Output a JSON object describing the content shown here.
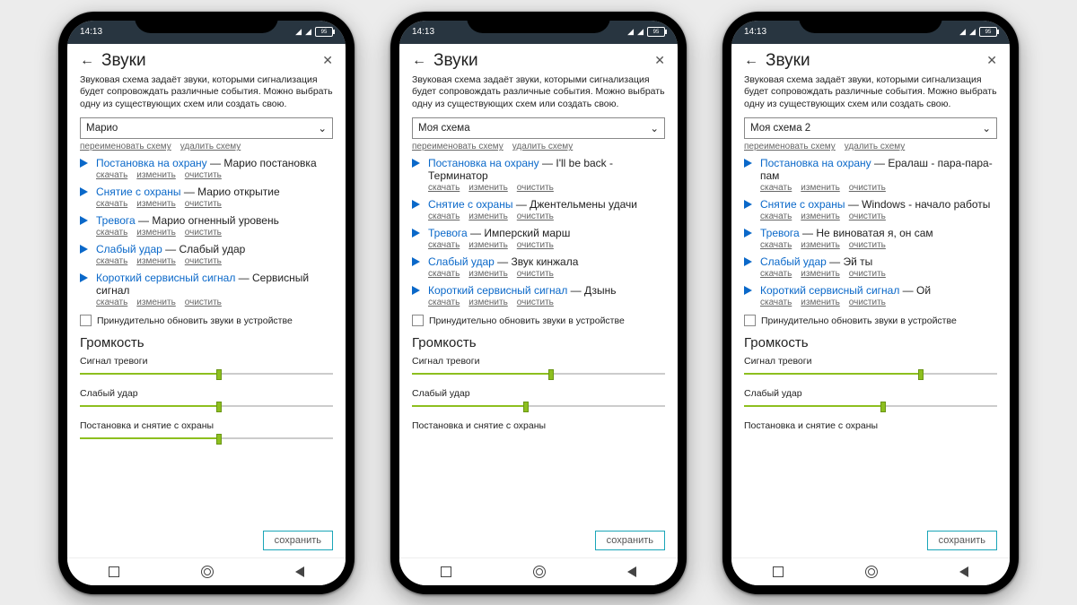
{
  "status": {
    "time": "14:13",
    "battery": "95"
  },
  "common": {
    "title": "Звуки",
    "desc": "Звуковая схема задаёт звуки, которыми сигнализация будет сопровождать различные события. Можно выбрать одну из существующих схем или создать свою.",
    "rename": "переименовать схему",
    "delete": "удалить схему",
    "download": "скачать",
    "edit": "изменить",
    "clear": "очистить",
    "force": "Принудительно обновить звуки в устройстве",
    "volume": "Громкость",
    "sliders": [
      "Сигнал тревоги",
      "Слабый удар",
      "Постановка и снятие с охраны"
    ],
    "save": "сохранить"
  },
  "phones": [
    {
      "scheme": "Марио",
      "items": [
        {
          "label": "Постановка на охрану",
          "file": "Марио постановка"
        },
        {
          "label": "Снятие с охраны",
          "file": "Марио открытие"
        },
        {
          "label": "Тревога",
          "file": "Марио огненный уровень"
        },
        {
          "label": "Слабый удар",
          "file": "Слабый удар"
        },
        {
          "label": "Короткий сервисный сигнал",
          "file": "Сервисный сигнал"
        }
      ],
      "sliders": [
        55,
        55,
        55
      ]
    },
    {
      "scheme": "Моя схема",
      "items": [
        {
          "label": "Постановка на охрану",
          "file": "I'll be back - Терминатор"
        },
        {
          "label": "Снятие с охраны",
          "file": "Джентельмены удачи"
        },
        {
          "label": "Тревога",
          "file": "Имперский марш"
        },
        {
          "label": "Слабый удар",
          "file": "Звук кинжала"
        },
        {
          "label": "Короткий сервисный сигнал",
          "file": "Дзынь"
        }
      ],
      "sliders": [
        55,
        45,
        null
      ]
    },
    {
      "scheme": "Моя схема 2",
      "items": [
        {
          "label": "Постановка на охрану",
          "file": "Ералаш   - пара-пара-пам"
        },
        {
          "label": "Снятие с охраны",
          "file": "Windows - начало работы"
        },
        {
          "label": "Тревога",
          "file": "Не виноватая я, он сам"
        },
        {
          "label": "Слабый удар",
          "file": "Эй ты"
        },
        {
          "label": "Короткий сервисный сигнал",
          "file": "Ой"
        }
      ],
      "sliders": [
        70,
        55,
        null
      ]
    }
  ]
}
